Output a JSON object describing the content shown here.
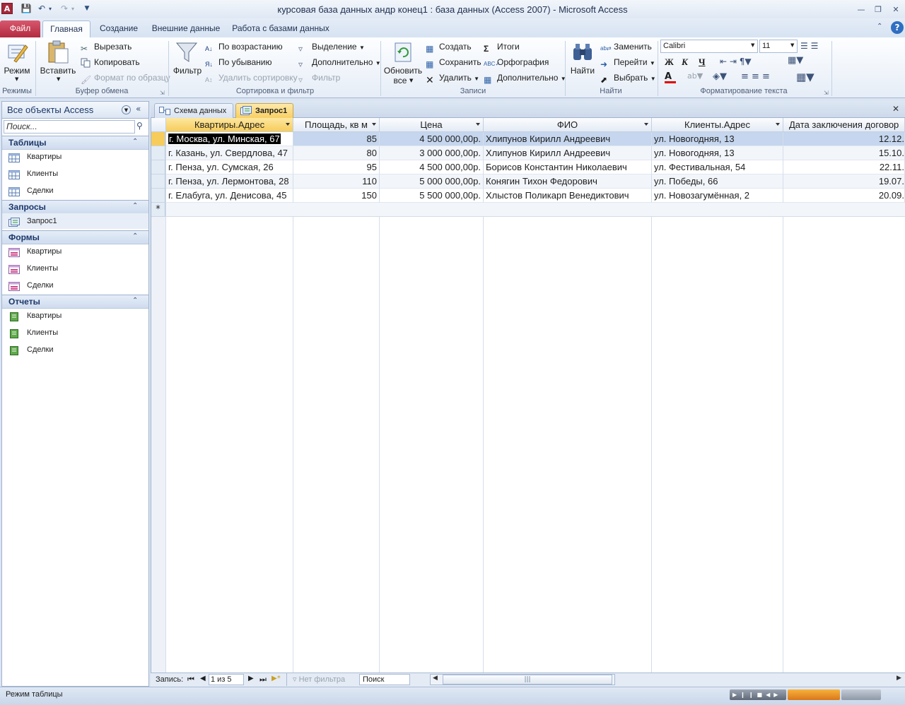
{
  "window": {
    "title": "курсовая база данных андр конец1 : база данных (Access 2007)  -  Microsoft Access",
    "app_icon_letter": "A"
  },
  "ribbon_tabs": [
    "Файл",
    "Главная",
    "Создание",
    "Внешние данные",
    "Работа с базами данных"
  ],
  "ribbon": {
    "views": {
      "label": "Режим",
      "group": "Режимы"
    },
    "clipboard": {
      "paste": "Вставить",
      "cut": "Вырезать",
      "copy": "Копировать",
      "format_painter": "Формат по образцу",
      "group": "Буфер обмена"
    },
    "sort_filter": {
      "filter": "Фильтр",
      "asc": "По возрастанию",
      "desc": "По убыванию",
      "remove_sort": "Удалить сортировку",
      "selection": "Выделение",
      "advanced": "Дополнительно",
      "toggle_filter": "Фильтр",
      "group": "Сортировка и фильтр"
    },
    "records": {
      "refresh": "Обновить",
      "refresh2": "все",
      "new": "Создать",
      "save": "Сохранить",
      "delete": "Удалить",
      "totals": "Итоги",
      "spelling": "Орфография",
      "more": "Дополнительно",
      "group": "Записи"
    },
    "find": {
      "find": "Найти",
      "replace": "Заменить",
      "goto": "Перейти",
      "select": "Выбрать",
      "group": "Найти"
    },
    "text_format": {
      "font": "Calibri",
      "size": "11",
      "bold": "Ж",
      "italic": "К",
      "underline": "Ч",
      "group": "Форматирование текста"
    }
  },
  "nav_pane": {
    "title": "Все объекты Access",
    "search_placeholder": "Поиск...",
    "groups": [
      {
        "label": "Таблицы",
        "items": [
          "Квартиры",
          "Клиенты",
          "Сделки"
        ]
      },
      {
        "label": "Запросы",
        "items": [
          "Запрос1"
        ]
      },
      {
        "label": "Формы",
        "items": [
          "Квартиры",
          "Клиенты",
          "Сделки"
        ]
      },
      {
        "label": "Отчеты",
        "items": [
          "Квартиры",
          "Клиенты",
          "Сделки"
        ]
      }
    ]
  },
  "doc_tabs": [
    "Схема данных",
    "Запрос1"
  ],
  "grid": {
    "columns": [
      "Квартиры.Адрес",
      "Площадь, кв м",
      "Цена",
      "ФИО",
      "Клиенты.Адрес",
      "Дата заключения договор"
    ],
    "rows": [
      [
        "г. Москва, ул. Минская, 67",
        "85",
        "4 500 000,00р.",
        "Хлипунов Кирилл Андреевич",
        "ул. Новогодняя, 13",
        "12.12."
      ],
      [
        "г. Казань, ул. Свердлова, 47",
        "80",
        "3 000 000,00р.",
        "Хлипунов Кирилл Андреевич",
        "ул. Новогодняя, 13",
        "15.10."
      ],
      [
        "г. Пенза, ул. Сумская, 26",
        "95",
        "4 500 000,00р.",
        "Борисов Константин Николаевич",
        "ул. Фестивальная, 54",
        "22.11."
      ],
      [
        "г. Пенза, ул. Лермонтова, 28",
        "110",
        "5 000 000,00р.",
        "Конягин Тихон Федорович",
        "ул. Победы, 66",
        "19.07."
      ],
      [
        "г. Елабуга, ул. Денисова, 45",
        "150",
        "5 500 000,00р.",
        "Хлыстов Поликарп Венедиктович",
        "ул. Новозагумённая, 2",
        "20.09."
      ]
    ],
    "new_row_marker": "*"
  },
  "record_nav": {
    "label": "Запись:",
    "position": "1 из 5",
    "filter": "Нет фильтра",
    "search": "Поиск"
  },
  "status": {
    "mode": "Режим таблицы"
  },
  "colors": {
    "accent": "#f7cc5a",
    "selected_row": "#c5d6ee",
    "file_tab": "#c0384e"
  }
}
